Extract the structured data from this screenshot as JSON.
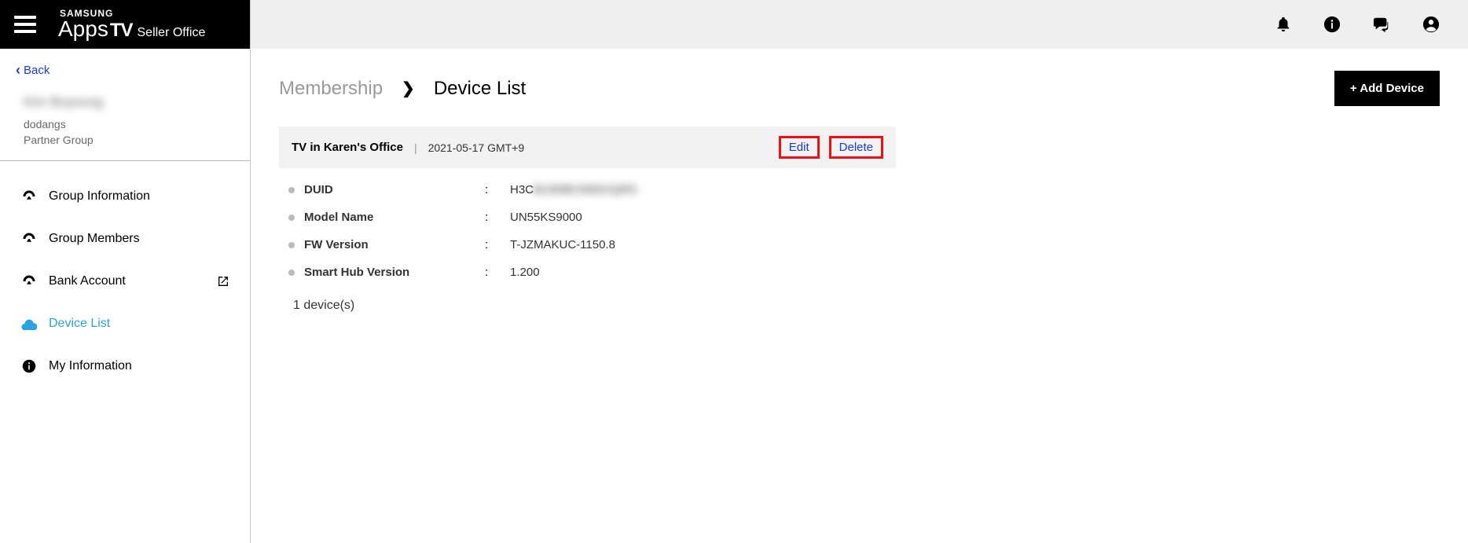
{
  "brand": {
    "samsung": "SAMSUNG",
    "apps": "Apps",
    "tv": "TV",
    "seller": "Seller Office"
  },
  "back_label": "Back",
  "user": {
    "name": "Kim Boyoung",
    "org": "dodangs",
    "role": "Partner Group"
  },
  "nav": {
    "items": [
      {
        "label": "Group Information"
      },
      {
        "label": "Group Members"
      },
      {
        "label": "Bank Account"
      },
      {
        "label": "Device List"
      },
      {
        "label": "My Information"
      }
    ]
  },
  "breadcrumb": {
    "a": "Membership",
    "b": "Device List"
  },
  "add_label": "+ Add Device",
  "device": {
    "title": "TV in Karen's Office",
    "date": "2021-05-17 GMT+9",
    "edit": "Edit",
    "delete": "Delete",
    "rows": [
      {
        "label": "DUID",
        "value": "H3C",
        "hidden": "B13DBCDEEXQRS"
      },
      {
        "label": "Model Name",
        "value": "UN55KS9000"
      },
      {
        "label": "FW Version",
        "value": "T-JZMAKUC-1150.8"
      },
      {
        "label": "Smart Hub Version",
        "value": "1.200"
      }
    ]
  },
  "count": "1 device(s)"
}
